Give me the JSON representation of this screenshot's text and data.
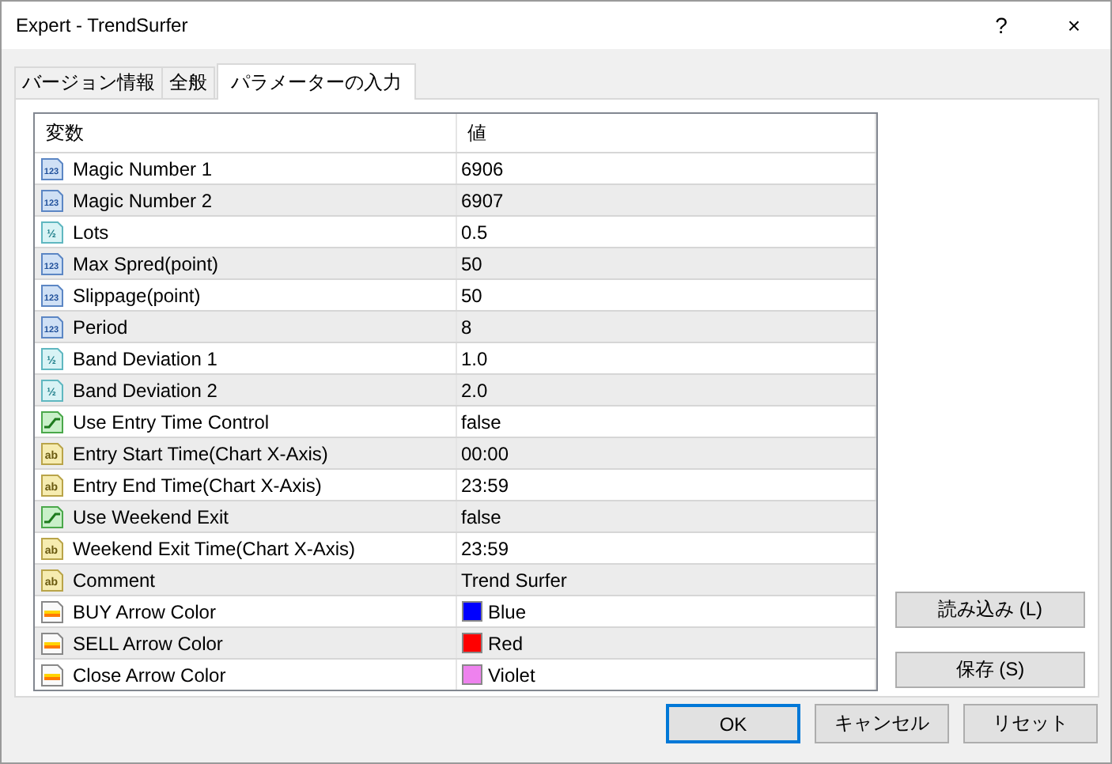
{
  "window": {
    "title": "Expert - TrendSurfer",
    "help": "?",
    "close": "×"
  },
  "tabs": [
    {
      "label": "バージョン情報",
      "selected": false
    },
    {
      "label": "全般",
      "selected": false
    },
    {
      "label": "パラメーターの入力",
      "selected": true
    }
  ],
  "table": {
    "columns": [
      "変数",
      "値"
    ],
    "rows": [
      {
        "kind": "int",
        "badge": "123",
        "name": "Magic Number 1",
        "value": "6906"
      },
      {
        "kind": "int",
        "badge": "123",
        "name": "Magic Number 2",
        "value": "6907"
      },
      {
        "kind": "double",
        "badge": "½",
        "name": "Lots",
        "value": "0.5"
      },
      {
        "kind": "int",
        "badge": "123",
        "name": "Max Spred(point)",
        "value": "50"
      },
      {
        "kind": "int",
        "badge": "123",
        "name": "Slippage(point)",
        "value": "50"
      },
      {
        "kind": "int",
        "badge": "123",
        "name": "Period",
        "value": "8"
      },
      {
        "kind": "double",
        "badge": "½",
        "name": "Band Deviation 1",
        "value": "1.0"
      },
      {
        "kind": "double",
        "badge": "½",
        "name": "Band Deviation 2",
        "value": "2.0"
      },
      {
        "kind": "bool",
        "name": "Use Entry Time Control",
        "value": "false"
      },
      {
        "kind": "string",
        "badge": "ab",
        "name": "Entry Start Time(Chart X-Axis)",
        "value": "00:00"
      },
      {
        "kind": "string",
        "badge": "ab",
        "name": "Entry End Time(Chart X-Axis)",
        "value": "23:59"
      },
      {
        "kind": "bool",
        "name": "Use Weekend Exit",
        "value": "false"
      },
      {
        "kind": "string",
        "badge": "ab",
        "name": "Weekend Exit Time(Chart X-Axis)",
        "value": "23:59"
      },
      {
        "kind": "string",
        "badge": "ab",
        "name": "Comment",
        "value": "Trend Surfer"
      },
      {
        "kind": "color",
        "name": "BUY Arrow Color",
        "value": "Blue",
        "color": "#0000ff"
      },
      {
        "kind": "color",
        "name": "SELL Arrow Color",
        "value": "Red",
        "color": "#ff0000"
      },
      {
        "kind": "color",
        "name": "Close Arrow Color",
        "value": "Violet",
        "color": "#ee82ee"
      }
    ]
  },
  "side_buttons": [
    "読み込み (L)",
    "保存 (S)"
  ],
  "buttons": [
    {
      "label": "OK",
      "default": true
    },
    {
      "label": "キャンセル",
      "default": false
    },
    {
      "label": "リセット",
      "default": false
    }
  ]
}
